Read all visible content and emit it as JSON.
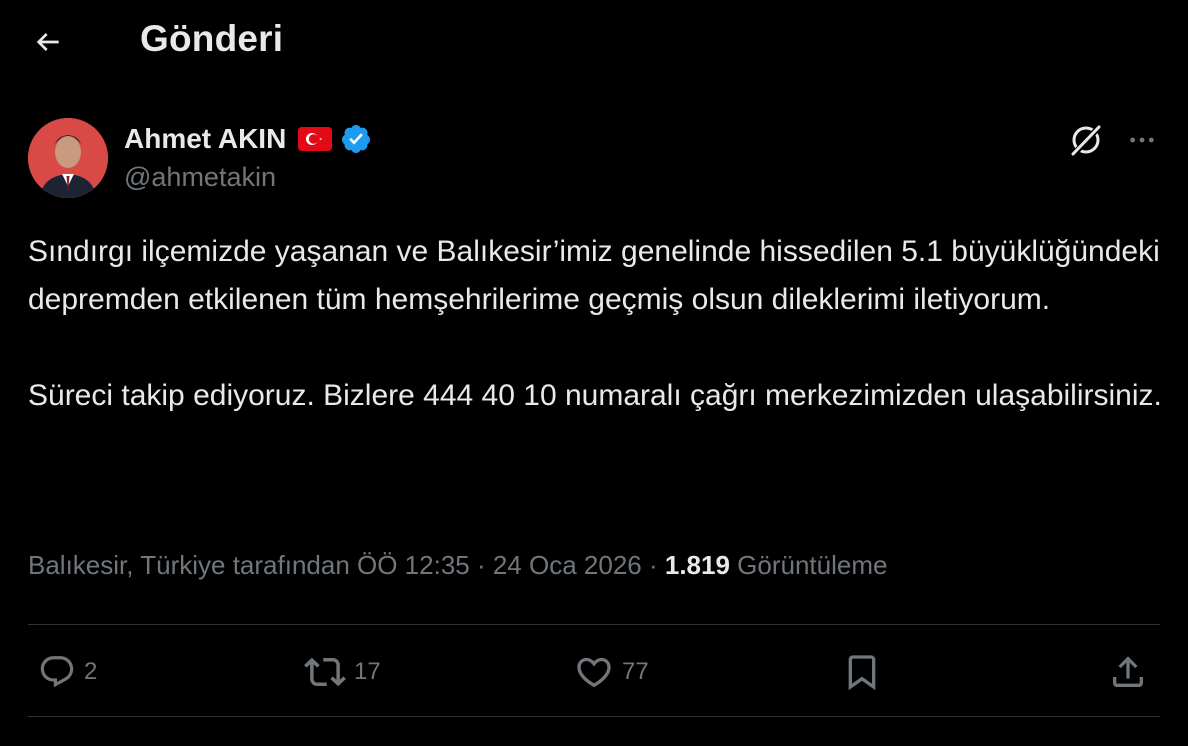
{
  "header": {
    "title": "Gönderi",
    "back_icon": "arrow-left-icon"
  },
  "author": {
    "name": "Ahmet AKIN",
    "handle": "@ahmetakin",
    "flag_icon": "turkey-flag-icon",
    "verified_icon": "verified-badge-icon",
    "verified_color": "#1d9bf0"
  },
  "tweet": {
    "paragraphs": [
      "Sındırgı ilçemizde yaşanan ve Balıkesir’imiz genelinde hissedilen 5.1 büyüklüğündeki depremden etkilenen tüm hemşehrilerime geçmiş olsun dileklerimi iletiyorum.",
      "Süreci takip ediyoruz. Bizlere 444 40 10 numaralı çağrı merkezimizden ulaşabilirsiniz."
    ]
  },
  "meta": {
    "location_prefix": "Balıkesir, Türkiye tarafından ÖÖ 12:35 · 24 Oca 2026 · ",
    "views_count": "1.819",
    "views_label": " Görüntüleme"
  },
  "actions": {
    "reply_count": "2",
    "retweet_count": "17",
    "like_count": "77"
  },
  "colors": {
    "background": "#000000",
    "text_primary": "#e7e9ea",
    "text_secondary": "#71767b",
    "divider": "#2f3336"
  }
}
